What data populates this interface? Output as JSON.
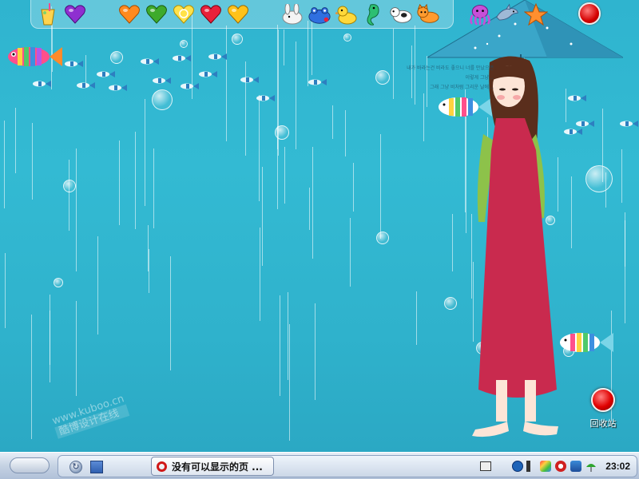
{
  "desktop": {
    "background_color": "#33bad3",
    "handwriting_lines": [
      "내가 바라는건 비라도 좋으니 너를 만났으면",
      "이렇게 그냥…",
      "그래 그냥 비처럼 그리운 날에…"
    ],
    "watermark": {
      "line1": "www.kuboo.cn",
      "line2": "酷博设计在线"
    },
    "recycle_bin": {
      "label": "回收站",
      "icon": "recycle-bin-icon"
    }
  },
  "top_dock": {
    "icons": [
      "drink-icon",
      "purple-heart-icon",
      "orange-heart-icon",
      "green-heart-icon",
      "lemon-heart-icon",
      "strawberry-heart-icon",
      "yellow-heart-icon",
      "bunny-icon",
      "blue-frog-icon",
      "duck-icon",
      "seahorse-icon",
      "cow-icon",
      "cat-icon",
      "octopus-icon",
      "dolphin-icon",
      "starfish-icon",
      "power-icon"
    ]
  },
  "taskbar": {
    "task_button_label": "没有可以显示的页 ...",
    "clock": "23:02",
    "accent": "#c5d2e3"
  }
}
